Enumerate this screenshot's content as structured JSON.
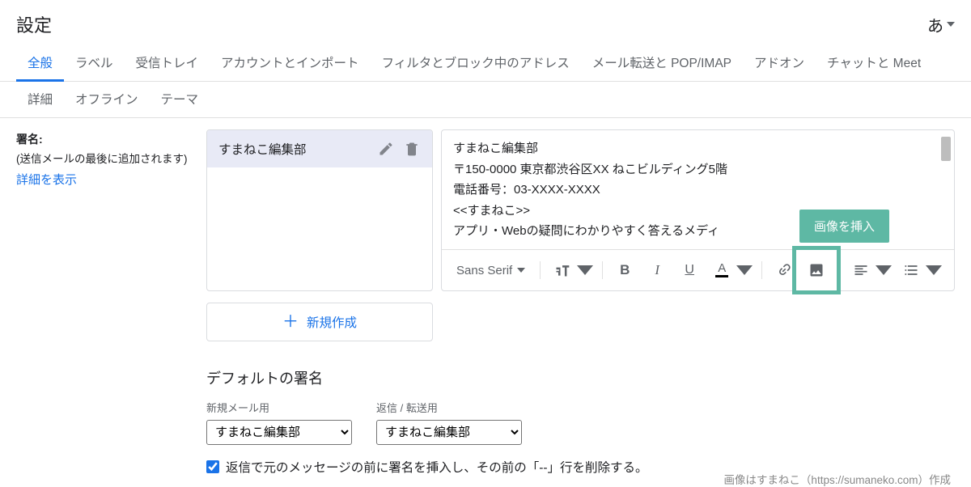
{
  "header": {
    "title": "設定",
    "lang": "あ"
  },
  "tabs": {
    "row1": [
      "全般",
      "ラベル",
      "受信トレイ",
      "アカウントとインポート",
      "フィルタとブロック中のアドレス",
      "メール転送と POP/IMAP",
      "アドオン",
      "チャットと Meet"
    ],
    "row2": [
      "詳細",
      "オフライン",
      "テーマ"
    ]
  },
  "left": {
    "label": "署名:",
    "hint": "(送信メールの最後に追加されます)",
    "details_link": "詳細を表示"
  },
  "signature_list": {
    "items": [
      {
        "name": "すまねこ編集部"
      }
    ]
  },
  "editor": {
    "lines": [
      "すまねこ編集部",
      "〒150-0000  東京都渋谷区XX ねこビルディング5階",
      "電話番号：03-XXXX-XXXX",
      "",
      "<<すまねこ>>",
      "アプリ・Webの疑問にわかりやすく答えるメディ"
    ],
    "font_name": "Sans Serif"
  },
  "tooltip": "画像を挿入",
  "new_button": "新規作成",
  "defaults": {
    "title": "デフォルトの署名",
    "new_mail_label": "新規メール用",
    "reply_label": "返信 / 転送用",
    "new_mail_value": "すまねこ編集部",
    "reply_value": "すまねこ編集部"
  },
  "checkbox": {
    "label": "返信で元のメッセージの前に署名を挿入し、その前の「--」行を削除する。"
  },
  "attribution": "画像はすまねこ（https://sumaneko.com）作成"
}
